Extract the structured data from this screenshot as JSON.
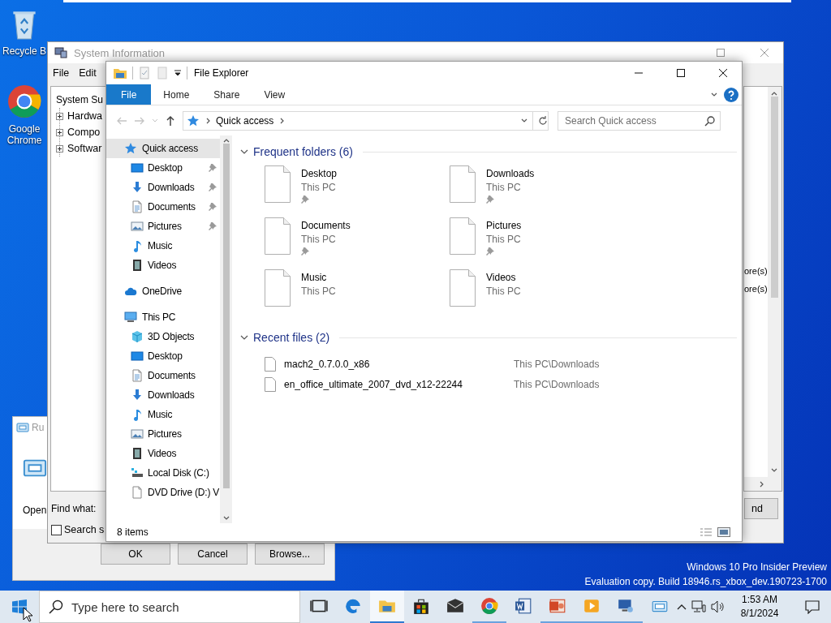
{
  "desktop": {
    "icons": [
      {
        "kind": "recycle",
        "label": "Recycle B"
      },
      {
        "kind": "chrome",
        "label": "Google Chrome"
      }
    ],
    "watermark": [
      "Windows 10 Pro Insider Preview",
      "Evaluation copy. Build 18946.rs_xbox_dev.190723-1700"
    ]
  },
  "run_dialog": {
    "title": "Ru",
    "open_label": "Open",
    "buttons": [
      "OK",
      "Cancel",
      "Browse..."
    ]
  },
  "system_information": {
    "title": "System Information",
    "menu": [
      "File",
      "Edit"
    ],
    "tree": {
      "label": "System Su",
      "children": [
        {
          "label": "Hardwa",
          "expanded": false
        },
        {
          "label": "Compo",
          "expanded": false
        },
        {
          "label": "Softwar",
          "expanded": false
        }
      ]
    },
    "list_text": [
      "ore(s)",
      "ore(s)"
    ],
    "find_label": "Find what:",
    "search_option": {
      "label": "Search s",
      "checked": false
    },
    "find_button": "nd"
  },
  "file_explorer": {
    "title": "File Explorer",
    "ribbon_tabs": [
      {
        "label": "File",
        "selected": true
      },
      {
        "label": "Home",
        "selected": false
      },
      {
        "label": "Share",
        "selected": false
      },
      {
        "label": "View",
        "selected": false
      }
    ],
    "address": "Quick access",
    "search": {
      "placeholder": "Search Quick access"
    },
    "navigation": [
      {
        "label": "Quick access",
        "kind": "star",
        "selected": true,
        "children": [
          {
            "label": "Desktop",
            "kind": "desktop",
            "pinned": true,
            "selected": false
          },
          {
            "label": "Downloads",
            "kind": "downloads",
            "pinned": true,
            "selected": false
          },
          {
            "label": "Documents",
            "kind": "documents",
            "pinned": true,
            "selected": false
          },
          {
            "label": "Pictures",
            "kind": "pictures",
            "pinned": true,
            "selected": false
          },
          {
            "label": "Music",
            "kind": "music",
            "pinned": false,
            "selected": false
          },
          {
            "label": "Videos",
            "kind": "videos",
            "pinned": false,
            "selected": false
          }
        ]
      },
      {
        "label": "OneDrive",
        "kind": "cloud",
        "selected": false
      },
      {
        "label": "This PC",
        "kind": "pc",
        "selected": false,
        "children": [
          {
            "label": "3D Objects",
            "kind": "objects3d",
            "selected": false
          },
          {
            "label": "Desktop",
            "kind": "desktop",
            "selected": false
          },
          {
            "label": "Documents",
            "kind": "documents",
            "selected": false
          },
          {
            "label": "Downloads",
            "kind": "downloads",
            "selected": false
          },
          {
            "label": "Music",
            "kind": "music",
            "selected": false
          },
          {
            "label": "Pictures",
            "kind": "pictures",
            "selected": false
          },
          {
            "label": "Videos",
            "kind": "videos",
            "selected": false
          },
          {
            "label": "Local Disk (C:)",
            "kind": "disk",
            "selected": false
          },
          {
            "label": "DVD Drive (D:) V",
            "kind": "dvd",
            "selected": false
          }
        ]
      }
    ],
    "frequent_folders": {
      "title": "Frequent folders (6)",
      "expanded": true,
      "items": [
        {
          "name": "Desktop",
          "location": "This PC",
          "pinned": true
        },
        {
          "name": "Downloads",
          "location": "This PC",
          "pinned": true
        },
        {
          "name": "Documents",
          "location": "This PC",
          "pinned": true
        },
        {
          "name": "Pictures",
          "location": "This PC",
          "pinned": true
        },
        {
          "name": "Music",
          "location": "This PC",
          "pinned": false
        },
        {
          "name": "Videos",
          "location": "This PC",
          "pinned": false
        }
      ]
    },
    "recent_files": {
      "title": "Recent files (2)",
      "expanded": true,
      "items": [
        {
          "name": "mach2_0.7.0.0_x86",
          "path": "This PC\\Downloads"
        },
        {
          "name": "en_office_ultimate_2007_dvd_x12-22244",
          "path": "This PC\\Downloads"
        }
      ]
    },
    "status": "8 items"
  },
  "taskbar": {
    "search": {
      "placeholder": "Type here to search"
    },
    "apps": [
      {
        "kind": "taskview",
        "running": false,
        "active": false
      },
      {
        "kind": "edge",
        "running": false,
        "active": false
      },
      {
        "kind": "explorer",
        "running": true,
        "active": true
      },
      {
        "kind": "store",
        "running": false,
        "active": false
      },
      {
        "kind": "mail",
        "running": false,
        "active": false
      },
      {
        "kind": "chrome",
        "running": true,
        "active": false
      },
      {
        "kind": "word",
        "running": false,
        "active": false
      },
      {
        "kind": "powerpoint",
        "running": true,
        "active": false
      },
      {
        "kind": "media",
        "running": true,
        "active": false
      },
      {
        "kind": "remote",
        "running": true,
        "active": false
      },
      {
        "kind": "run",
        "running": false,
        "active": false
      }
    ],
    "clock": {
      "time": "1:53 AM",
      "date": "8/1/2024"
    }
  }
}
